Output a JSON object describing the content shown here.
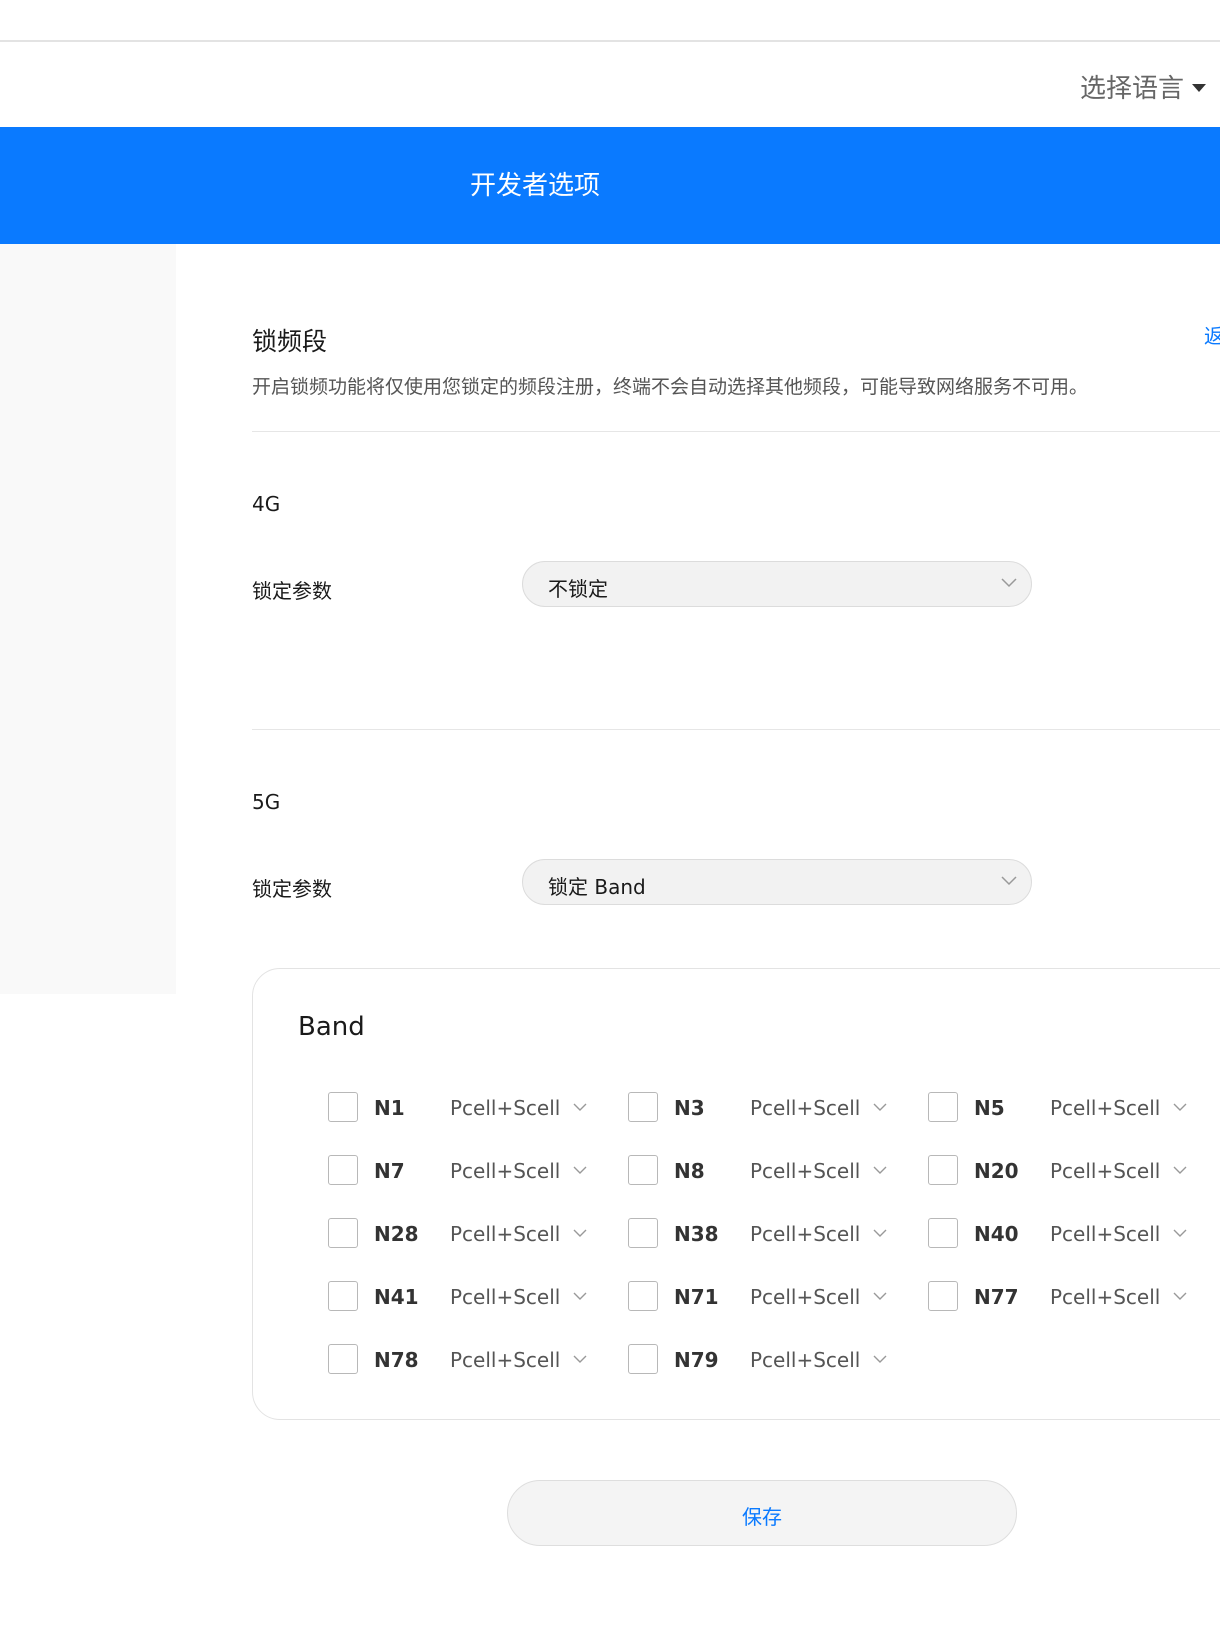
{
  "header": {
    "language_select_label": "选择语言"
  },
  "banner": {
    "title": "开发者选项"
  },
  "section": {
    "title": "锁频段",
    "back_link": "返回",
    "description": "开启锁频功能将仅使用您锁定的频段注册，终端不会自动选择其他频段，可能导致网络服务不可用。"
  },
  "lte": {
    "group_label": "4G",
    "field_label": "锁定参数",
    "selected_value": "不锁定"
  },
  "nr": {
    "group_label": "5G",
    "field_label": "锁定参数",
    "selected_value": "锁定 Band"
  },
  "band_panel": {
    "title": "Band",
    "bands": [
      {
        "name": "N1",
        "mode": "Pcell+Scell",
        "checked": false
      },
      {
        "name": "N3",
        "mode": "Pcell+Scell",
        "checked": false
      },
      {
        "name": "N5",
        "mode": "Pcell+Scell",
        "checked": false
      },
      {
        "name": "N7",
        "mode": "Pcell+Scell",
        "checked": false
      },
      {
        "name": "N8",
        "mode": "Pcell+Scell",
        "checked": false
      },
      {
        "name": "N20",
        "mode": "Pcell+Scell",
        "checked": false
      },
      {
        "name": "N28",
        "mode": "Pcell+Scell",
        "checked": false
      },
      {
        "name": "N38",
        "mode": "Pcell+Scell",
        "checked": false
      },
      {
        "name": "N40",
        "mode": "Pcell+Scell",
        "checked": false
      },
      {
        "name": "N41",
        "mode": "Pcell+Scell",
        "checked": false
      },
      {
        "name": "N71",
        "mode": "Pcell+Scell",
        "checked": false
      },
      {
        "name": "N77",
        "mode": "Pcell+Scell",
        "checked": false
      },
      {
        "name": "N78",
        "mode": "Pcell+Scell",
        "checked": false
      },
      {
        "name": "N79",
        "mode": "Pcell+Scell",
        "checked": false
      }
    ]
  },
  "actions": {
    "save_label": "保存"
  },
  "colors": {
    "accent": "#0a7aff",
    "banner_text": "#ffffff",
    "side_panel": "#f9f9f9"
  }
}
